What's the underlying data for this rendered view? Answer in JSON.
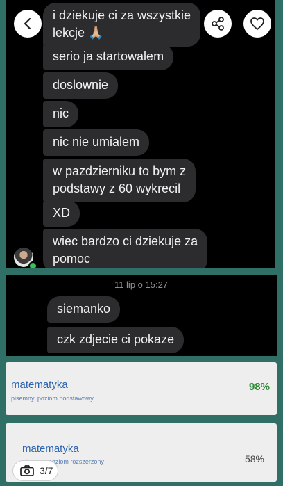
{
  "chat_top": {
    "messages": [
      "i dziekuje ci za wszystkie\nlekcje 🙏🏼",
      "serio ja startowalem",
      "doslownie",
      "nic",
      "nic nie umialem",
      "w pazdzierniku to bym z\npodstawy z 60 wykrecil",
      "XD",
      "wiec bardzo ci dziekuje za\npomoc"
    ]
  },
  "chat_bottom": {
    "timestamp": "11 lip o 15:27",
    "messages": [
      "siemanko",
      "czk zdjecie ci pokaze"
    ]
  },
  "grades": [
    {
      "subject": "matematyka",
      "level": "pisemny, poziom podstawowy",
      "percent": "98%",
      "percent_color": "#2e8b3a"
    },
    {
      "subject": "matematyka",
      "level": "pisemny, poziom rozszerzony",
      "percent": "58%",
      "percent_color": "#444444"
    }
  ],
  "viewer": {
    "counter": "3/7",
    "icons": [
      "back-icon",
      "share-icon",
      "heart-icon",
      "camera-icon"
    ]
  },
  "colors": {
    "chat_background": "#000000",
    "bubble": "#2c2c2e",
    "page_background": "#2f6f66",
    "online": "#36c15a"
  }
}
